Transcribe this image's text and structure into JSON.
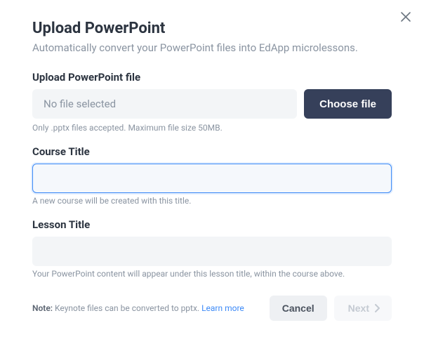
{
  "header": {
    "title": "Upload PowerPoint",
    "subtitle": "Automatically convert your PowerPoint files into EdApp microlessons."
  },
  "file_field": {
    "label": "Upload PowerPoint file",
    "no_file_text": "No file selected",
    "choose_label": "Choose file",
    "hint": "Only .pptx files accepted. Maximum file size 50MB."
  },
  "course_field": {
    "label": "Course Title",
    "value": "",
    "hint": "A new course will be created with this title."
  },
  "lesson_field": {
    "label": "Lesson Title",
    "value": "",
    "hint": "Your PowerPoint content will appear under this lesson title, within the course above."
  },
  "footer": {
    "note_strong": "Note:",
    "note_text": " Keynote files can be converted to pptx. ",
    "learn_more": "Learn more",
    "cancel_label": "Cancel",
    "next_label": "Next"
  }
}
